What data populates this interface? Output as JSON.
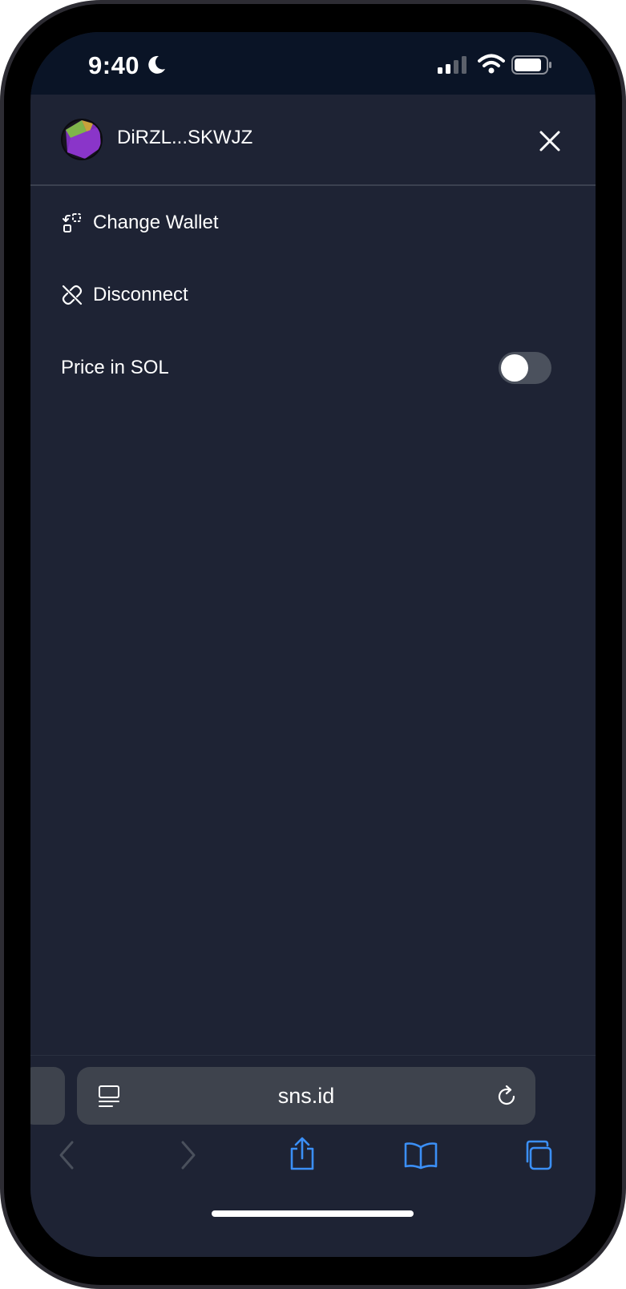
{
  "status": {
    "time": "9:40"
  },
  "wallet": {
    "address": "DiRZL...SKWJZ"
  },
  "menu": {
    "change_wallet": "Change Wallet",
    "disconnect": "Disconnect",
    "price_in_sol": "Price in SOL",
    "price_in_sol_enabled": false
  },
  "browser": {
    "url": "sns.id"
  },
  "icons": {
    "close": "close-icon",
    "change_wallet": "change-wallet-icon",
    "disconnect": "unlink-icon",
    "reader": "reader-icon",
    "reload": "reload-icon",
    "back": "chevron-left-icon",
    "forward": "chevron-right-icon",
    "share": "share-icon",
    "bookmarks": "book-icon",
    "tabs": "tabs-icon"
  },
  "colors": {
    "background": "#1e2334",
    "status_bar": "#0a1426",
    "accent_blue": "#3b8ff6",
    "toggle_off": "#4b515d"
  }
}
